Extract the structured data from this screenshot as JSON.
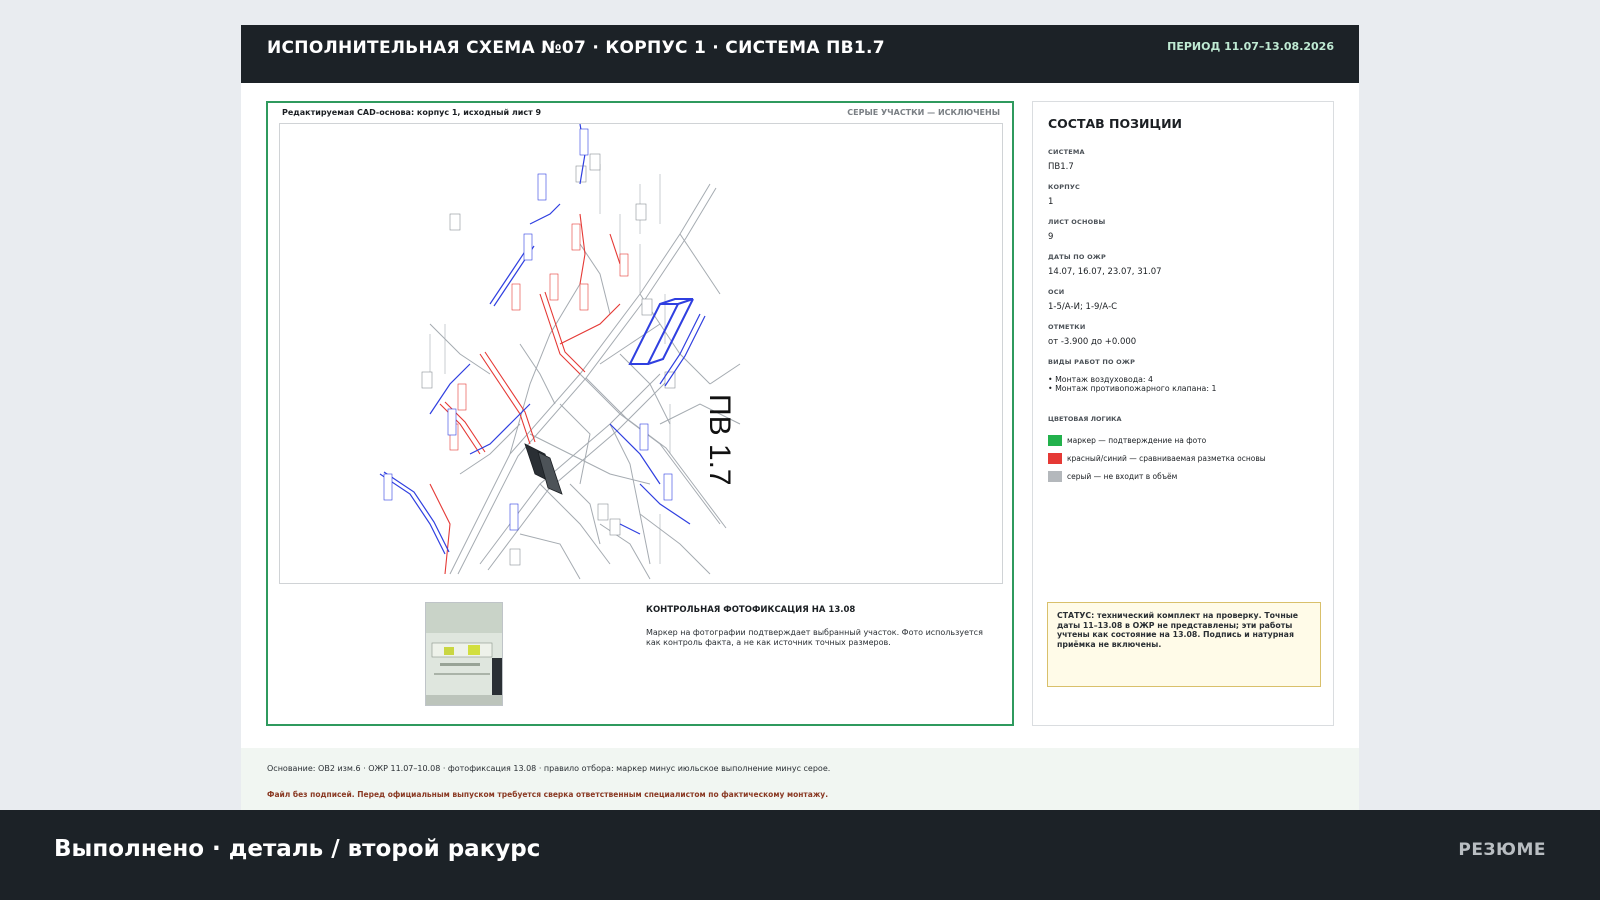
{
  "sheet": {
    "title": "ИСПОЛНИТЕЛЬНАЯ СХЕМА №07  ·  КОРПУС 1  ·  СИСТЕМА ПВ1.7",
    "period": "ПЕРИОД 11.07–13.08.2026"
  },
  "drawing": {
    "caption": "Редактируемая CAD-основа: корпус 1, исходный лист 9",
    "note": "СЕРЫЕ УЧАСТКИ — ИСКЛЮЧЕНЫ",
    "system_label": "ПВ 1.7",
    "colors": {
      "red": "#e53935",
      "blue": "#2f3fe0",
      "gray": "#9aa0a6",
      "frame": "#2f9a5e"
    }
  },
  "photo": {
    "title": "КОНТРОЛЬНАЯ ФОТОФИКСАЦИЯ НА 13.08",
    "text": "Маркер на фотографии подтверждает выбранный участок. Фото используется как контроль факта, а не как источник точных размеров."
  },
  "panel": {
    "title": "СОСТАВ ПОЗИЦИИ",
    "fields": [
      {
        "label": "Система",
        "value": "ПВ1.7"
      },
      {
        "label": "Корпус",
        "value": "1"
      },
      {
        "label": "Лист основы",
        "value": "9"
      },
      {
        "label": "Даты по ОЖР",
        "value": "14.07, 16.07, 23.07, 31.07"
      },
      {
        "label": "Оси",
        "value": "1-5/А-И; 1-9/А-С"
      },
      {
        "label": "Отметки",
        "value": "от -3.900 до +0.000"
      },
      {
        "label": "Виды работ по ОЖР",
        "value": "• Монтаж воздуховода: 4",
        "value2": "• Монтаж противопожарного клапана: 1"
      }
    ],
    "legend": {
      "title": "ЦВЕТОВАЯ ЛОГИКА",
      "items": [
        {
          "color": "#22b14c",
          "text": "маркер — подтверждение на фото"
        },
        {
          "color": "#e53935",
          "text": "красный/синий — сравниваемая разметка основы"
        },
        {
          "color": "#b4b8bc",
          "text": "серый — не входит в объём"
        }
      ]
    },
    "status": "СТАТУС: технический комплект на проверку. Точные даты 11–13.08 в ОЖР не представлены; эти работы учтены как состояние на 13.08. Подпись и натурная приёмка не включены."
  },
  "footer": {
    "basis": "Основание: ОВ2 изм.6 · ОЖР 11.07–10.08 · фотофиксация 13.08 · правило отбора: маркер минус июльское выполнение минус серое.",
    "warning": "Файл без подписей. Перед официальным выпуском требуется сверка ответственным специалистом по фактическому монтажу."
  },
  "bottom": {
    "title": "Выполнено · деталь / второй ракурс",
    "summary": "РЕЗЮМЕ"
  }
}
